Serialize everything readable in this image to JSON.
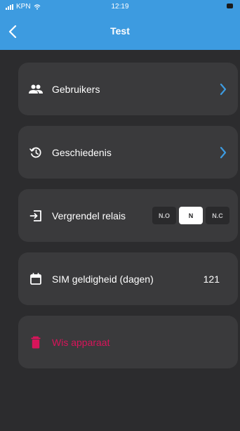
{
  "status_bar": {
    "carrier": "KPN",
    "time": "12:19"
  },
  "header": {
    "title": "Test"
  },
  "menu": {
    "users": {
      "label": "Gebruikers"
    },
    "history": {
      "label": "Geschiedenis"
    },
    "relay": {
      "label": "Vergrendel relais",
      "options": [
        "N.O",
        "N",
        "N.C"
      ],
      "selected": "N"
    },
    "sim": {
      "label": "SIM geldigheid (dagen)",
      "value": "121"
    },
    "delete": {
      "label": "Wis apparaat"
    }
  },
  "colors": {
    "header_bg": "#3d9be0",
    "background": "#2c2c2e",
    "card": "#3a3a3c",
    "accent": "#3d9be0",
    "danger": "#d8145a"
  }
}
